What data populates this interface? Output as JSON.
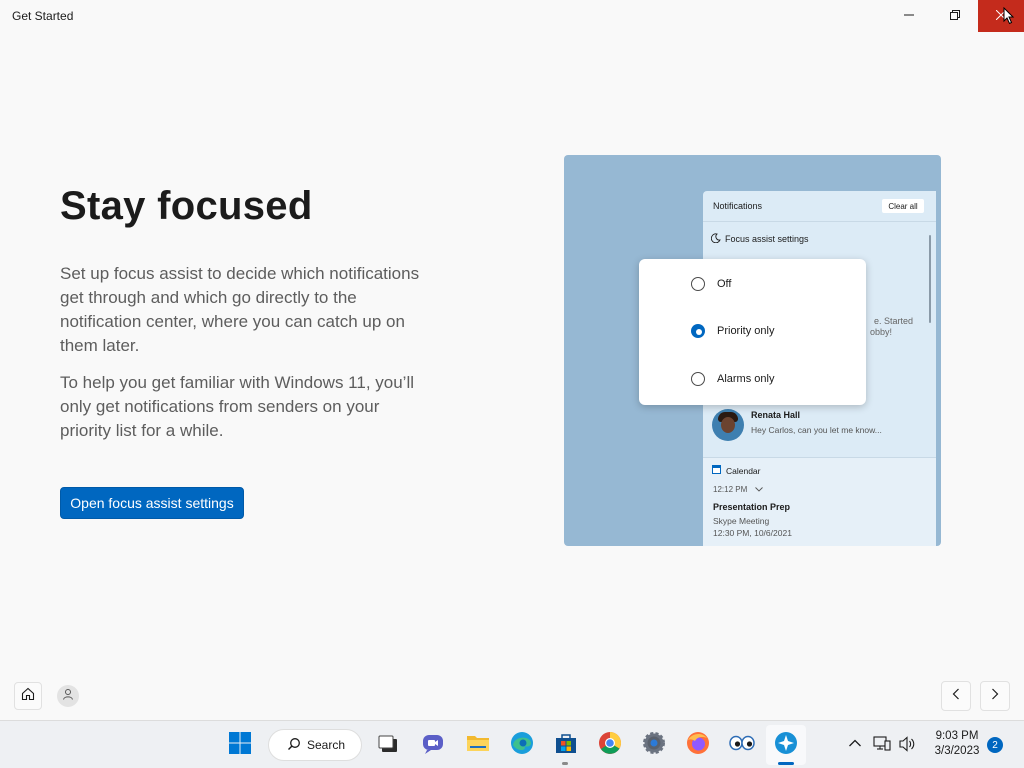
{
  "window": {
    "title": "Get Started",
    "controls": {
      "minimize": "minimize-icon",
      "maximize": "restore-icon",
      "close": "close-icon"
    }
  },
  "page": {
    "heading": "Stay focused",
    "paragraph1": "Set up focus assist to decide which notifications get through and which go directly to the notification center, where you can catch up on them later.",
    "paragraph2": "To help you get familiar with Windows 11, you’ll only get notifications from senders on your priority list for a while.",
    "primary_button": "Open focus assist settings"
  },
  "illustration": {
    "notifications_header": "Notifications",
    "clear_all": "Clear all",
    "focus_assist_link": "Focus assist settings",
    "fragment1": "e. Started",
    "fragment2": "obby!",
    "options": [
      {
        "label": "Off",
        "selected": false
      },
      {
        "label": "Priority only",
        "selected": true
      },
      {
        "label": "Alarms only",
        "selected": false
      }
    ],
    "message": {
      "sender": "Renata Hall",
      "preview": "Hey Carlos, can you let me know..."
    },
    "calendar": {
      "label": "Calendar",
      "time": "12:12 PM",
      "event_title": "Presentation Prep",
      "event_subtitle": "Skype Meeting",
      "event_datetime": "12:30 PM, 10/6/2021"
    }
  },
  "nav": {
    "home": "home-icon",
    "account": "person-icon",
    "prev": "chevron-left-icon",
    "next": "chevron-right-icon"
  },
  "taskbar": {
    "search_label": "Search",
    "apps": [
      "start",
      "search",
      "task-view",
      "teams-chat",
      "file-explorer",
      "edge",
      "store",
      "chrome",
      "settings",
      "firefox",
      "eyes-app",
      "get-started"
    ],
    "clock_time": "9:03 PM",
    "clock_date": "3/3/2023",
    "notification_count": "2"
  },
  "colors": {
    "accent": "#0067c0",
    "close_hover": "#c42b1c",
    "illustration_bg": "#96b8d3"
  }
}
